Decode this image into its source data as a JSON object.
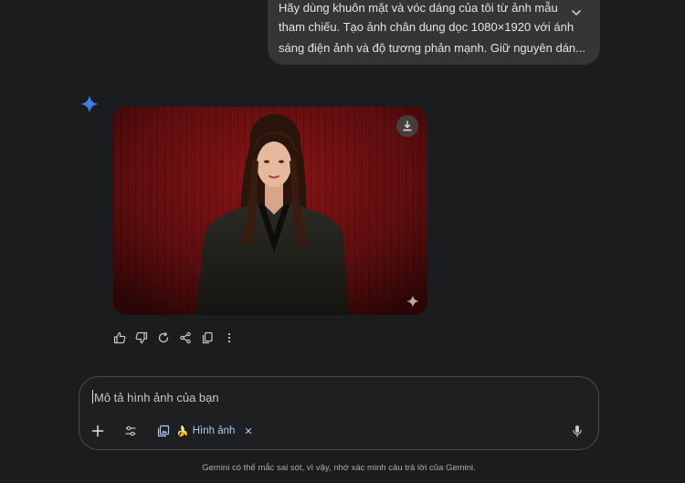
{
  "user_message": {
    "lines": [
      "Hãy dùng khuôn mặt và vóc dáng của tôi từ ảnh mẫu",
      "tham chiếu. Tạo ảnh chân dung dọc 1080×1920 với ánh",
      "sáng điện ảnh và độ tương phản mạnh. Giữ nguyên dán..."
    ]
  },
  "colors": {
    "background": "#1b1c1d",
    "bubble": "#333537",
    "gemini_spark": "#4a8cf0",
    "chip_text": "#a8c7fa",
    "photo_backdrop": "#6b0f10"
  },
  "icons": {
    "expand": "chevron-down-icon",
    "spark": "gemini-spark-icon",
    "download": "download-icon",
    "ai_mark": "ai-sparkle-icon",
    "like": "thumbs-up-icon",
    "dislike": "thumbs-down-icon",
    "regenerate": "refresh-icon",
    "share": "share-icon",
    "copy": "copy-icon",
    "more": "more-vert-icon",
    "add": "plus-icon",
    "tools": "tune-icon",
    "chip_image": "image-gallery-icon",
    "chip_emoji": "banana-emoji",
    "chip_close": "close-icon",
    "mic": "microphone-icon"
  },
  "composer": {
    "placeholder": "Mô tả hình ảnh của bạn",
    "value": "",
    "chip": {
      "emoji": "🍌",
      "label": "Hình ảnh",
      "close": "✕"
    }
  },
  "footer": {
    "disclaimer": "Gemini có thể mắc sai sót, vì vậy, nhớ xác minh câu trả lời của Gemini."
  }
}
